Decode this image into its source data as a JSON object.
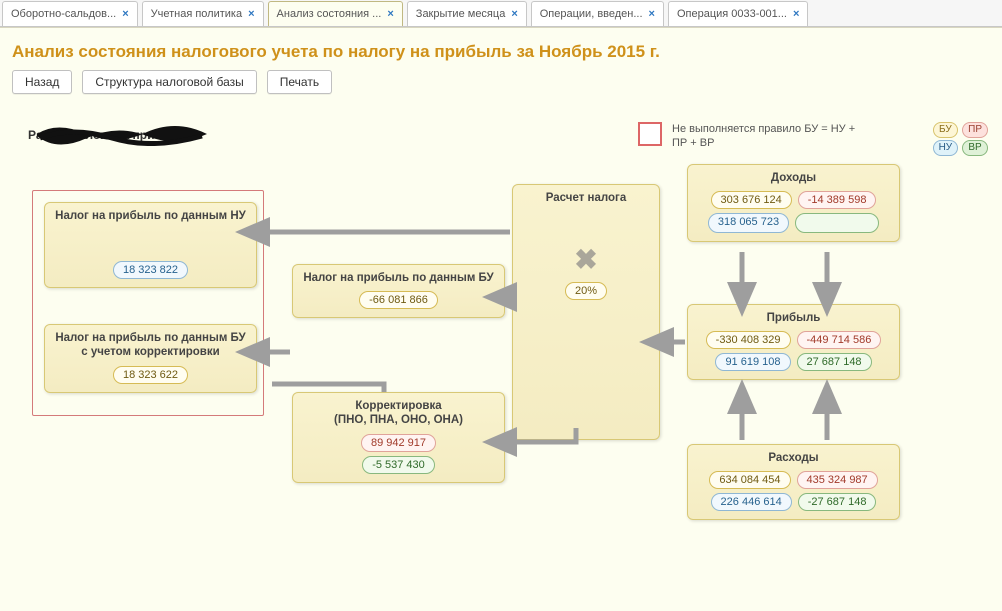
{
  "tabs": [
    {
      "label": "Оборотно-сальдов..."
    },
    {
      "label": "Учетная политика"
    },
    {
      "label": "Анализ состояния ...",
      "active": true
    },
    {
      "label": "Закрытие месяца"
    },
    {
      "label": "Операции, введен..."
    },
    {
      "label": "Операция 0033-001..."
    }
  ],
  "heading": "Анализ состояния налогового учета по налогу на прибыль за Ноябрь 2015 г.",
  "toolbar": {
    "back": "Назад",
    "structure": "Структура налоговой базы",
    "print": "Печать"
  },
  "subtitle": "Расчет налога на прибыль",
  "legend": {
    "rule": "Не выполняется правило БУ = НУ + ПР + ВР",
    "bu": "БУ",
    "pr": "ПР",
    "nu": "НУ",
    "vr": "ВР"
  },
  "blocks": {
    "tax_nu": {
      "title": "Налог на прибыль по данным НУ",
      "nu": "18 323 822"
    },
    "tax_bu_corr": {
      "title": "Налог на прибыль по данным БУ с учетом корректировки",
      "bu": "18 323 622"
    },
    "tax_bu": {
      "title": "Налог на прибыль по данным БУ",
      "bu": "-66 081 866"
    },
    "correction": {
      "title": "Корректировка\n(ПНО, ПНА, ОНО, ОНА)",
      "pr": "89 942 917",
      "vr": "-5 537 430"
    },
    "calc": {
      "title": "Расчет налога",
      "rate": "20%"
    },
    "income": {
      "title": "Доходы",
      "bu": "303 676 124",
      "pr": "-14 389 598",
      "nu": "318 065 723",
      "vr": ""
    },
    "profit": {
      "title": "Прибыль",
      "bu": "-330 408 329",
      "pr": "-449 714 586",
      "nu": "91 619 108",
      "vr": "27 687 148"
    },
    "expense": {
      "title": "Расходы",
      "bu": "634 084 454",
      "pr": "435 324 987",
      "nu": "226 446 614",
      "vr": "-27 687 148"
    }
  }
}
